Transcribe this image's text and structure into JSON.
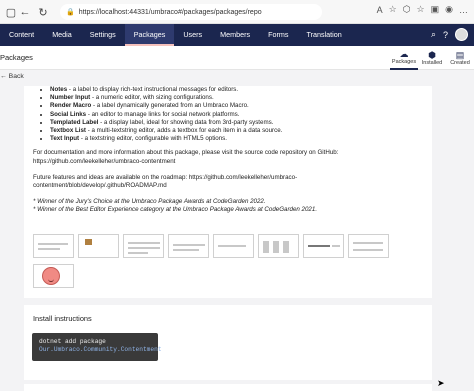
{
  "browser": {
    "url": "https://localhost:44331/umbraco#/packages/packages/repo"
  },
  "nav": {
    "items": [
      "Content",
      "Media",
      "Settings",
      "Packages",
      "Users",
      "Members",
      "Forms",
      "Translation"
    ],
    "active": "Packages"
  },
  "section": {
    "title": "Packages",
    "tabs": [
      {
        "label": "Packages",
        "icon": "cloud-icon"
      },
      {
        "label": "Installed",
        "icon": "box-icon"
      },
      {
        "label": "Created",
        "icon": "document-icon"
      }
    ]
  },
  "back_label": "← Back",
  "editors": [
    {
      "name": "Notes",
      "desc": " - a label to display rich-text instructional messages for editors."
    },
    {
      "name": "Number Input",
      "desc": " - a numeric editor, with sizing configurations."
    },
    {
      "name": "Render Macro",
      "desc": " - a label dynamically generated from an Umbraco Macro."
    },
    {
      "name": "Social Links",
      "desc": " - an editor to manage links for social network platforms."
    },
    {
      "name": "Templated Label",
      "desc": " - a display label, ideal for showing data from 3rd-party systems."
    },
    {
      "name": "Textbox List",
      "desc": " - a multi-textstring editor, adds a textbox for each item in a data source."
    },
    {
      "name": "Text Input",
      "desc": " - a textstring editor, configurable with HTML5 options."
    }
  ],
  "doc_text": "For documentation and more information about this package, please visit the source code repository on GitHub: https://github.com/leekelleher/umbraco-contentment",
  "future_text": "Future features and ideas are available on the roadmap: https://github.com/leekelleher/umbraco-contentment/blob/develop/.github/ROADMAP.md",
  "awards": [
    "* Winner of the Jury's Choice at the Umbraco Package Awards at CodeGarden 2022.",
    "* Winner of the Best Editor Experience category at the Umbraco Package Awards at CodeGarden 2021."
  ],
  "install": {
    "title": "Install instructions",
    "command": "dotnet add package",
    "package": "Our.Umbraco.Community.Contentment"
  }
}
